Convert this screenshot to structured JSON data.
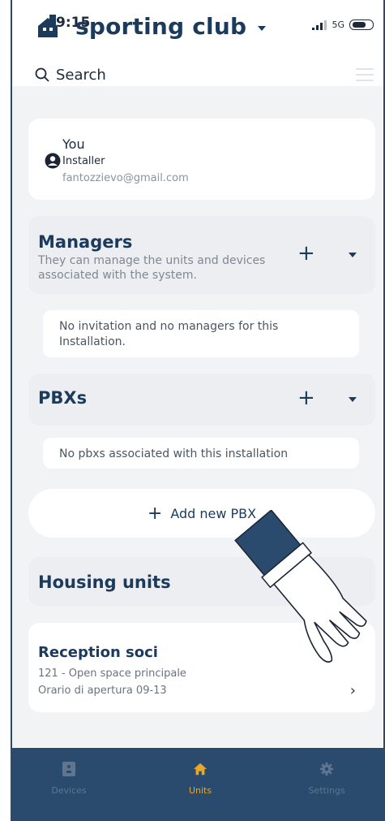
{
  "status_bar": {
    "time": "9:15",
    "network": "5G"
  },
  "header": {
    "title": "sporting club"
  },
  "search": {
    "placeholder": "Search"
  },
  "user": {
    "name": "You",
    "role": "Installer",
    "email": "fantozzievo@gmail.com"
  },
  "managers": {
    "title": "Managers",
    "description": "They can manage the units and devices associated with the system.",
    "empty_text": "No invitation and no managers for this Installation."
  },
  "pbxs": {
    "title": "PBXs",
    "empty_text": "No pbxs associated with this installation"
  },
  "add_pbx": {
    "label": "Add new PBX"
  },
  "housing_units": {
    "title": "Housing units"
  },
  "unit": {
    "title": "Reception soci",
    "line1": "121 - Open space principale",
    "line2": "Orario di apertura 09-13"
  },
  "tabs": [
    {
      "label": "Devices",
      "active": false
    },
    {
      "label": "Units",
      "active": true
    },
    {
      "label": "Settings",
      "active": false
    }
  ],
  "colors": {
    "accent": "#e6a72a",
    "primary": "#1b3a5c",
    "tabbar": "#2a4a6e"
  }
}
